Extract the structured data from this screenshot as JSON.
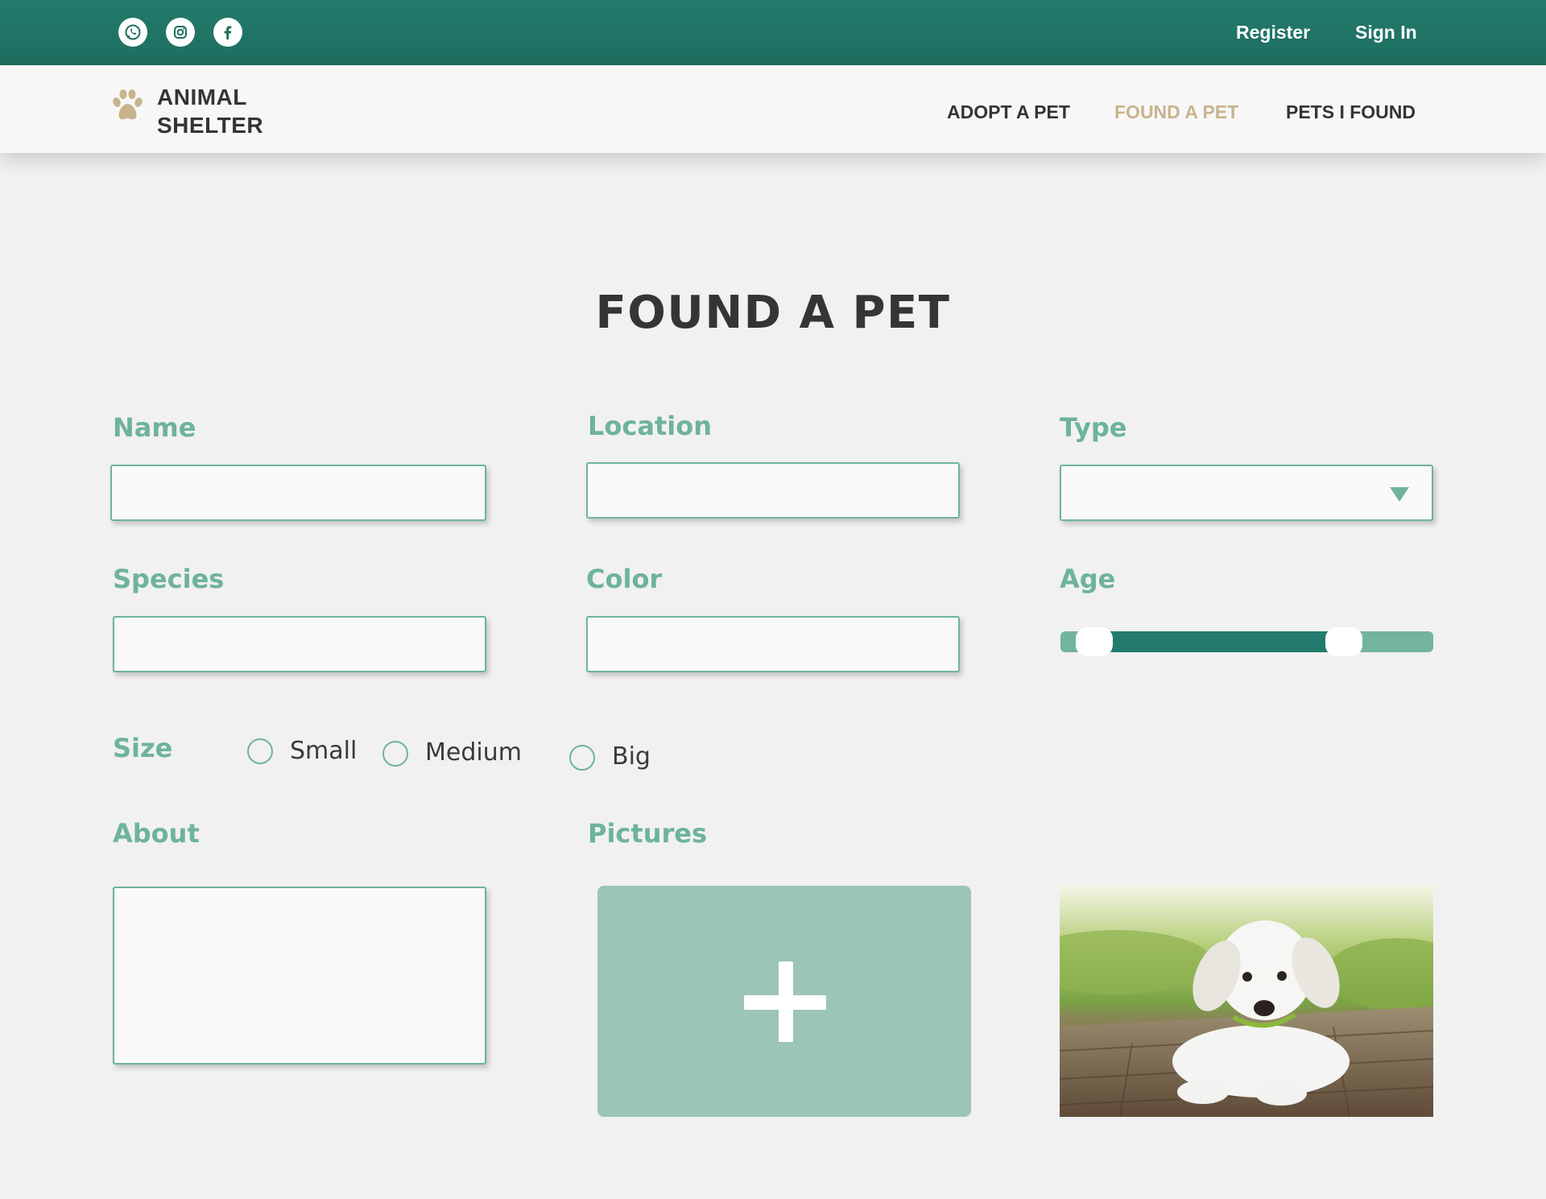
{
  "topbar": {
    "social": [
      {
        "icon": "whatsapp-icon"
      },
      {
        "icon": "instagram-icon"
      },
      {
        "icon": "facebook-icon"
      }
    ],
    "register_label": "Register",
    "signin_label": "Sign In"
  },
  "brand": {
    "line1": "ANIMAL",
    "line2": "SHELTER",
    "icon": "paw-icon"
  },
  "nav": {
    "items": [
      {
        "label": "ADOPT A PET",
        "active": false
      },
      {
        "label": "FOUND A PET",
        "active": true
      },
      {
        "label": "PETS I FOUND",
        "active": false
      }
    ]
  },
  "form": {
    "title": "FOUND A PET",
    "name_label": "Name",
    "location_label": "Location",
    "type_label": "Type",
    "species_label": "Species",
    "color_label": "Color",
    "age_label": "Age",
    "age_range": {
      "low_fraction": 0.09,
      "high_fraction": 0.76
    },
    "size_label": "Size",
    "size_options": [
      "Small",
      "Medium",
      "Big"
    ],
    "about_label": "About",
    "pictures_label": "Pictures"
  },
  "colors": {
    "primary": "#227b6c",
    "accent_label": "#6eb39b",
    "nav_active": "#c8b48c",
    "upload_bg": "#9cc5b5"
  }
}
